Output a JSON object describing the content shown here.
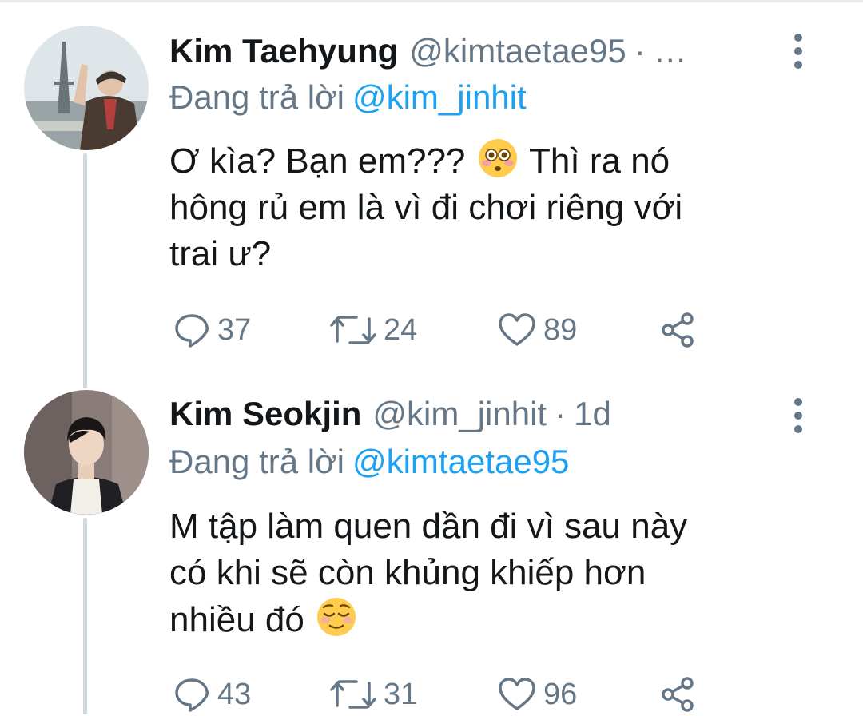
{
  "tweets": [
    {
      "name": "Kim Taehyung",
      "handle": "@kimtaetae95",
      "dot": "·",
      "time": "…",
      "reply_prefix": "Đang trả lời",
      "reply_to": "@kim_jinhit",
      "text_line1": "Ơ kìa? Bạn em???",
      "text_line1_after_emoji": " Thì ra nó",
      "text_line2": "hông rủ em là vì đi chơi riêng với",
      "text_line3": "trai ư?",
      "emoji": "flushed-face-emoji",
      "replies": "37",
      "retweets": "24",
      "likes": "89"
    },
    {
      "name": "Kim Seokjin",
      "handle": "@kim_jinhit",
      "dot": "·",
      "time": "1d",
      "reply_prefix": "Đang trả lời",
      "reply_to": "@kimtaetae95",
      "text_line1": "M tập làm quen dần đi vì sau này",
      "text_line2": "có khi sẽ còn khủng khiếp hơn",
      "text_line3": "nhiều đó",
      "emoji": "relieved-face-emoji",
      "replies": "43",
      "retweets": "31",
      "likes": "96"
    }
  ],
  "colors": {
    "text": "#14171a",
    "secondary": "#657786",
    "mention": "#1da1f2",
    "thread_line": "#cfd9de"
  }
}
